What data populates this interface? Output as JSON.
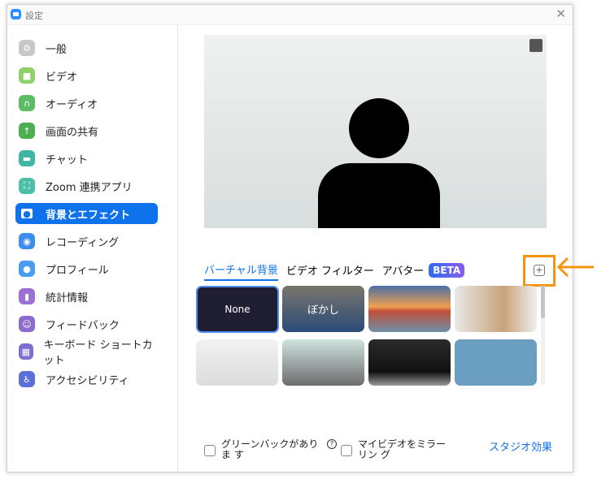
{
  "window": {
    "title": "設定"
  },
  "sidebar": {
    "items": [
      {
        "label": "一般",
        "icon": "gear-icon",
        "color": "#c8c8c8"
      },
      {
        "label": "ビデオ",
        "icon": "video-icon",
        "color": "#8fd06a"
      },
      {
        "label": "オーディオ",
        "icon": "headphones-icon",
        "color": "#5dbb63"
      },
      {
        "label": "画面の共有",
        "icon": "share-screen-icon",
        "color": "#4caf50"
      },
      {
        "label": "チャット",
        "icon": "chat-icon",
        "color": "#3fb5a3"
      },
      {
        "label": "Zoom 連携アプリ",
        "icon": "apps-icon",
        "color": "#4dbfa6"
      },
      {
        "label": "背景とエフェクト",
        "icon": "background-icon",
        "color": "#ffffff",
        "active": true
      },
      {
        "label": "レコーディング",
        "icon": "record-icon",
        "color": "#3d8ef0"
      },
      {
        "label": "プロフィール",
        "icon": "profile-icon",
        "color": "#4a9cf0"
      },
      {
        "label": "統計情報",
        "icon": "stats-icon",
        "color": "#9b6fd6"
      },
      {
        "label": "フィードバック",
        "icon": "feedback-icon",
        "color": "#8c6ad0"
      },
      {
        "label": "キーボード ショートカット",
        "icon": "keyboard-icon",
        "color": "#7f6ed0"
      },
      {
        "label": "アクセシビリティ",
        "icon": "accessibility-icon",
        "color": "#5c6fd8"
      }
    ]
  },
  "tabs": [
    {
      "label": "バーチャル背景"
    },
    {
      "label": "ビデオ フィルター"
    },
    {
      "label": "アバター"
    }
  ],
  "beta_badge": "BETA",
  "thumbnails": [
    {
      "label": "None"
    },
    {
      "label": "ぼかし"
    }
  ],
  "options": {
    "green_screen": "グリーンバックがありま す",
    "mirror": "マイビデオをミラーリン グ",
    "studio": "スタジオ効果"
  },
  "accent": "#0e72ed",
  "highlight": "#f5950f"
}
